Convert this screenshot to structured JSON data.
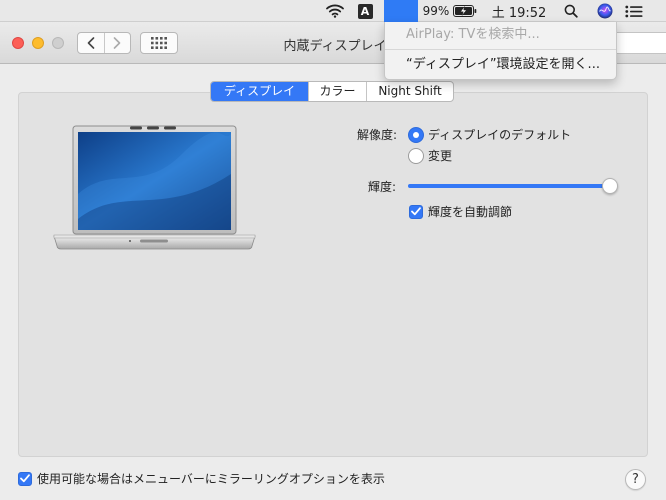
{
  "menubar": {
    "battery_percent": "99%",
    "clock": "土 19:52",
    "input_source": "A",
    "icons": [
      "wifi-icon",
      "input-source-icon",
      "display-menu-icon",
      "battery-charging-icon",
      "search-icon",
      "siri-icon",
      "notification-center-icon"
    ]
  },
  "dropdown": {
    "disabled_item": "AirPlay: TVを検索中...",
    "action_item": "“ディスプレイ”環境設定を開く..."
  },
  "window": {
    "title": "内蔵ディスプレイ"
  },
  "tabs": [
    {
      "label": "ディスプレイ",
      "selected": true
    },
    {
      "label": "カラー",
      "selected": false
    },
    {
      "label": "Night Shift",
      "selected": false
    }
  ],
  "display": {
    "resolution_label": "解像度:",
    "resolution_options": [
      {
        "label": "ディスプレイのデフォルト",
        "selected": true
      },
      {
        "label": "変更",
        "selected": false
      }
    ],
    "brightness_label": "輝度:",
    "brightness_level": 1.0,
    "auto_brightness_label": "輝度を自動調節",
    "auto_brightness_checked": true
  },
  "footer": {
    "mirroring_label": "使用可能な場合はメニューバーにミラーリングオプションを表示",
    "mirroring_checked": true,
    "help_label": "?"
  },
  "colors": {
    "accent": "#3478f6",
    "close": "#fc5f57",
    "minimize": "#fdbc2e"
  }
}
